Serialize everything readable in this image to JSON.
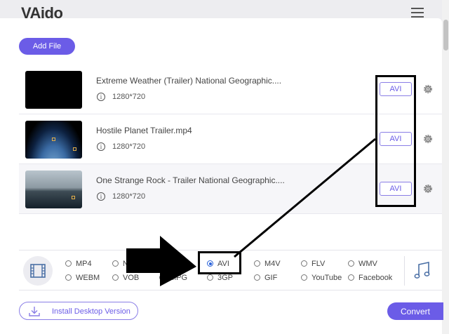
{
  "app": {
    "logo_text": "VAido"
  },
  "toolbar": {
    "add_file_label": "Add File"
  },
  "files": [
    {
      "name": "Extreme Weather (Trailer) National Geographic....",
      "resolution": "1280*720",
      "format": "AVI",
      "thumbnail": "black"
    },
    {
      "name": "Hostile Planet Trailer.mp4",
      "resolution": "1280*720",
      "format": "AVI",
      "thumbnail": "earth-orbit"
    },
    {
      "name": "One Strange Rock - Trailer National Geographic....",
      "resolution": "1280*720",
      "format": "AVI",
      "thumbnail": "ocean-rock"
    }
  ],
  "formats": {
    "row1": [
      "MP4",
      "N",
      "AVI",
      "M4V",
      "FLV",
      "WMV"
    ],
    "row2": [
      "WEBM",
      "VOB",
      "MPG",
      "3GP",
      "GIF",
      "YouTube",
      "Facebook"
    ],
    "selected": "AVI"
  },
  "footer": {
    "install_label": "Install Desktop Version",
    "convert_label": "Convert"
  },
  "icons": {
    "info": "info-icon",
    "settings": "gear-icon",
    "video_tab": "film-icon",
    "audio_tab": "music-note-icon",
    "download": "download-icon",
    "menu": "hamburger-icon"
  },
  "colors": {
    "accent": "#6b5ce7",
    "radio_selected": "#2a62d9",
    "annotation": "#000000"
  }
}
